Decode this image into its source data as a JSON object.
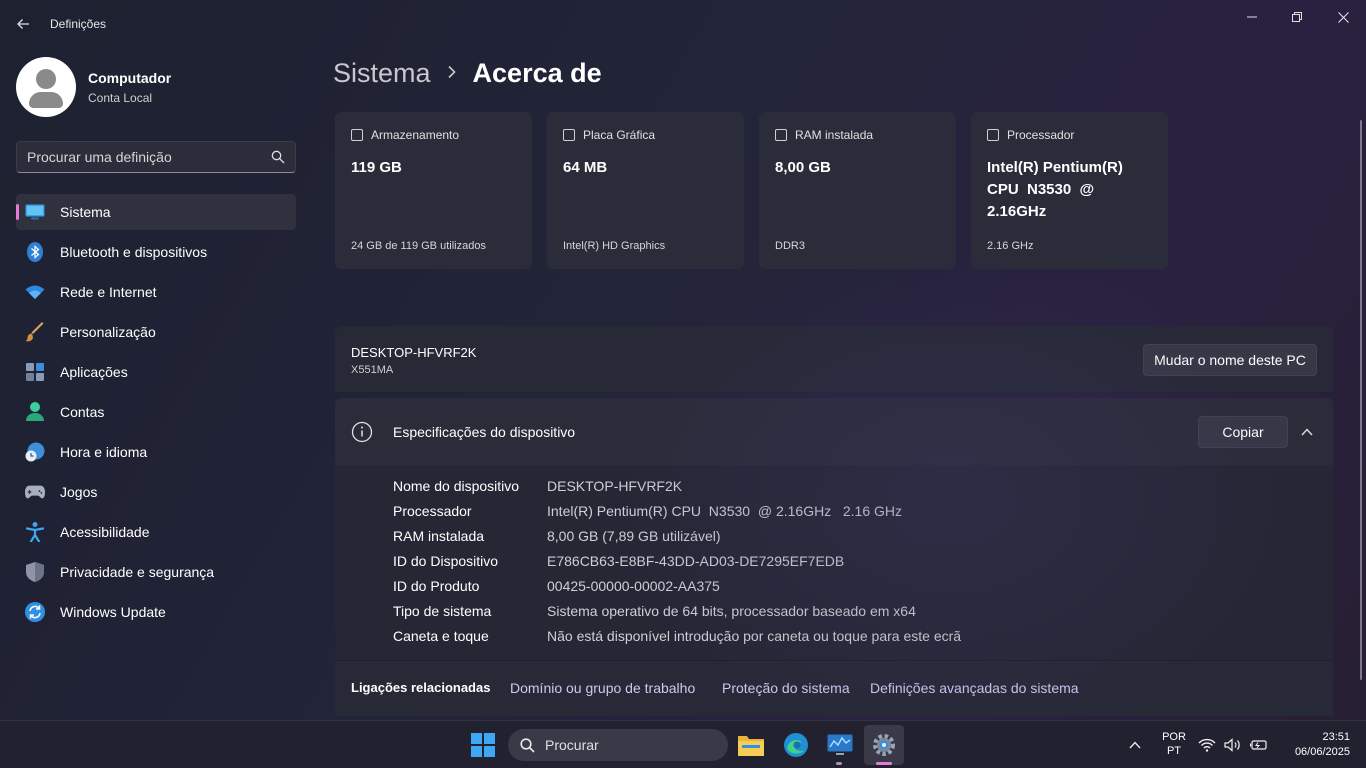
{
  "window": {
    "title": "Definições"
  },
  "profile": {
    "name": "Computador",
    "account": "Conta Local"
  },
  "search": {
    "placeholder": "Procurar uma definição"
  },
  "nav": [
    {
      "label": "Sistema",
      "icon": "monitor-icon",
      "active": true
    },
    {
      "label": "Bluetooth e dispositivos",
      "icon": "bluetooth-icon"
    },
    {
      "label": "Rede e Internet",
      "icon": "wifi-icon"
    },
    {
      "label": "Personalização",
      "icon": "brush-icon"
    },
    {
      "label": "Aplicações",
      "icon": "apps-icon"
    },
    {
      "label": "Contas",
      "icon": "person-icon"
    },
    {
      "label": "Hora e idioma",
      "icon": "globe-clock-icon"
    },
    {
      "label": "Jogos",
      "icon": "gamepad-icon"
    },
    {
      "label": "Acessibilidade",
      "icon": "accessibility-icon"
    },
    {
      "label": "Privacidade e segurança",
      "icon": "shield-icon"
    },
    {
      "label": "Windows Update",
      "icon": "update-icon"
    }
  ],
  "breadcrumb": {
    "parent": "Sistema",
    "current": "Acerca de"
  },
  "cards": [
    {
      "title": "Armazenamento",
      "value": "119 GB",
      "footer": "24 GB de 119 GB utilizados",
      "icon": "storage-icon"
    },
    {
      "title": "Placa Gráfica",
      "value": "64 MB",
      "footer": "Intel(R) HD Graphics",
      "icon": "gpu-icon"
    },
    {
      "title": "RAM instalada",
      "value": "8,00 GB",
      "footer": "DDR3",
      "icon": "ram-icon"
    },
    {
      "title": "Processador",
      "value": "Intel(R) Pentium(R) CPU  N3530  @ 2.16GHz",
      "footer": "2.16 GHz",
      "icon": "cpu-icon"
    }
  ],
  "pc": {
    "name": "DESKTOP-HFVRF2K",
    "model": "X551MA",
    "rename_label": "Mudar o nome deste PC"
  },
  "specs": {
    "title": "Especificações do dispositivo",
    "copy_label": "Copiar",
    "rows": [
      {
        "label": "Nome do dispositivo",
        "value": "DESKTOP-HFVRF2K"
      },
      {
        "label": "Processador",
        "value": "Intel(R) Pentium(R) CPU  N3530  @ 2.16GHz   2.16 GHz"
      },
      {
        "label": "RAM instalada",
        "value": "8,00 GB (7,89 GB utilizável)"
      },
      {
        "label": "ID do Dispositivo",
        "value": "E786CB63-E8BF-43DD-AD03-DE7295EF7EDB"
      },
      {
        "label": "ID do Produto",
        "value": "00425-00000-00002-AA375"
      },
      {
        "label": "Tipo de sistema",
        "value": "Sistema operativo de 64 bits, processador baseado em x64"
      },
      {
        "label": "Caneta e toque",
        "value": "Não está disponível introdução por caneta ou toque para este ecrã"
      }
    ]
  },
  "related": {
    "label": "Ligações relacionadas",
    "links": [
      "Domínio ou grupo de trabalho",
      "Proteção do sistema",
      "Definições avançadas do sistema"
    ]
  },
  "taskbar": {
    "search_label": "Procurar",
    "language": "POR",
    "region": "PT",
    "time": "23:51",
    "date": "06/06/2025"
  }
}
